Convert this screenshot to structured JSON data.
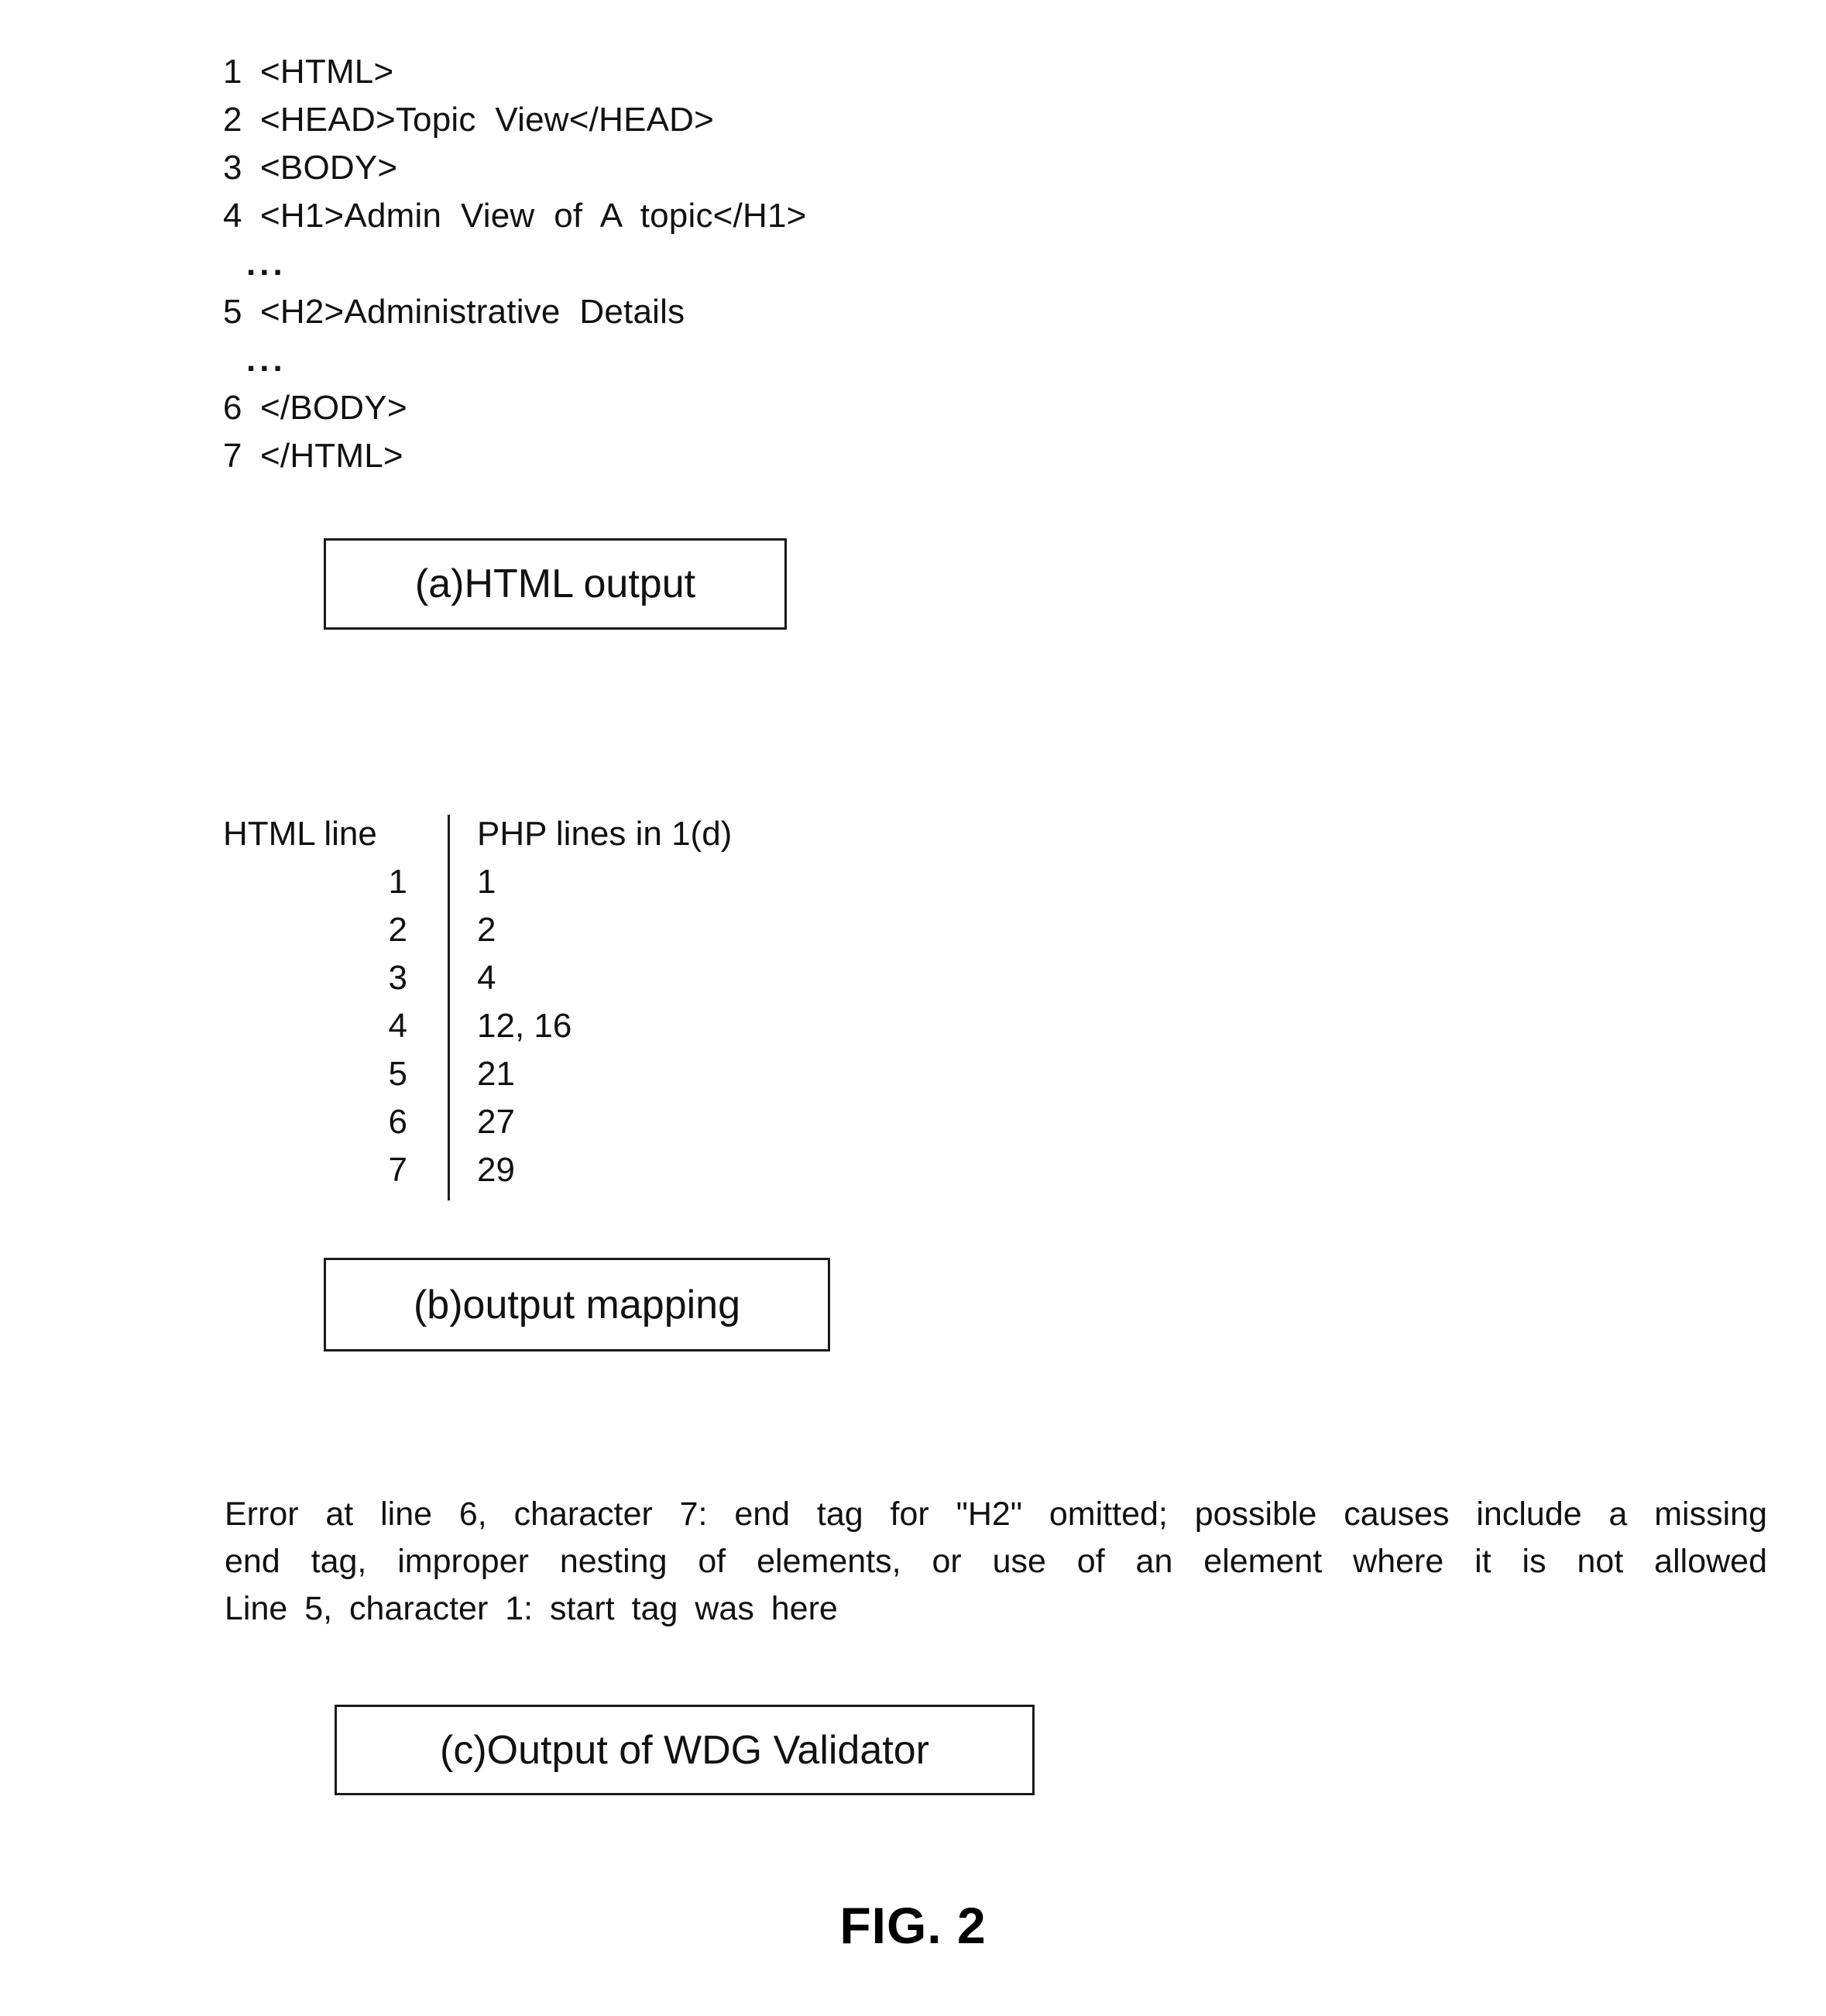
{
  "figure": {
    "label": "FIG. 2"
  },
  "html_output": {
    "lines": [
      {
        "number": "1",
        "code": "<HTML>"
      },
      {
        "number": "2",
        "code": "<HEAD>Topic  View</HEAD>"
      },
      {
        "number": "3",
        "code": "<BODY>"
      },
      {
        "number": "4",
        "code": "<H1>Admin  View  of  A  topic</H1>"
      },
      {
        "number": "5",
        "code": "<H2>Administrative  Details"
      },
      {
        "number": "6",
        "code": "</BODY>"
      },
      {
        "number": "7",
        "code": "</HTML>"
      }
    ],
    "ellipsis": "...",
    "caption": "(a)HTML output"
  },
  "output_mapping": {
    "headers": {
      "left": "HTML line",
      "right": "PHP lines in 1(d)"
    },
    "rows": [
      {
        "html_line": "1",
        "php_lines": "1"
      },
      {
        "html_line": "2",
        "php_lines": "2"
      },
      {
        "html_line": "3",
        "php_lines": "4"
      },
      {
        "html_line": "4",
        "php_lines": "12, 16"
      },
      {
        "html_line": "5",
        "php_lines": "21"
      },
      {
        "html_line": "6",
        "php_lines": "27"
      },
      {
        "html_line": "7",
        "php_lines": "29"
      }
    ],
    "caption": "(b)output mapping"
  },
  "validator_output": {
    "line1": "Error at line 6, character 7:   end tag for \"H2\" omitted; possible causes include a missing",
    "line2": "end tag, improper nesting of elements, or use of an element where it is not allowed",
    "line3": "Line 5, character 1:   start tag was here",
    "caption": "(c)Output of WDG Validator"
  }
}
